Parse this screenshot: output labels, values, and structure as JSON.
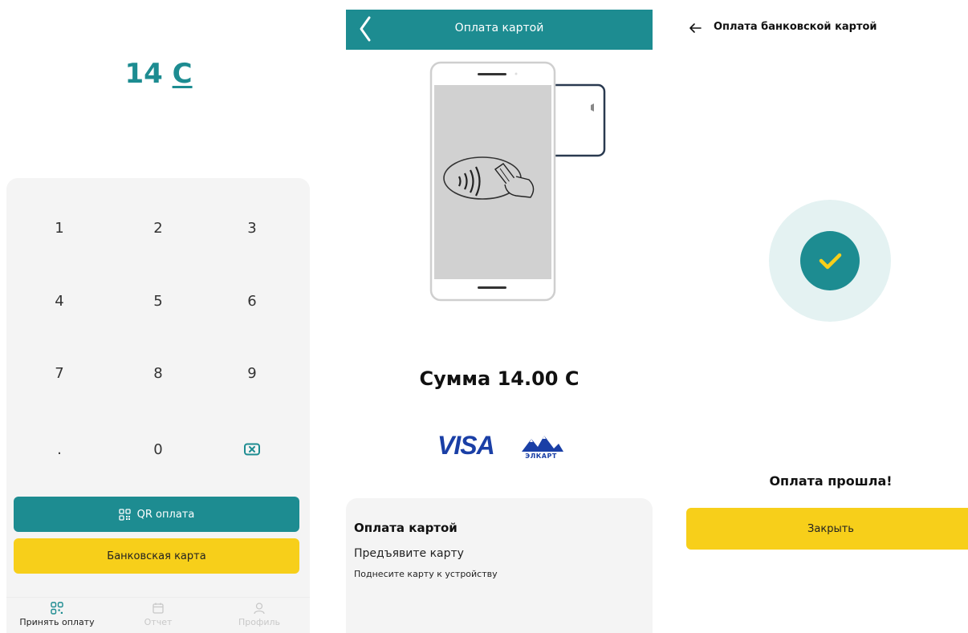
{
  "colors": {
    "teal": "#1d8c91",
    "yellow": "#f7cf1a",
    "light_gray": "#f4f4f4",
    "light_teal": "#e4f2f2"
  },
  "screen1": {
    "amount": "14",
    "currency": "С",
    "keys": [
      "1",
      "2",
      "3",
      "4",
      "5",
      "6",
      "7",
      "8",
      "9",
      ".",
      "0"
    ],
    "backspace_icon": "backspace-icon",
    "qr_button": "QR оплата",
    "card_button": "Банковская карта",
    "tabs": [
      {
        "label": "Принять оплату",
        "icon": "qr-code-icon",
        "active": true
      },
      {
        "label": "Отчет",
        "icon": "calendar-icon",
        "active": false
      },
      {
        "label": "Профиль",
        "icon": "profile-icon",
        "active": false
      }
    ]
  },
  "screen2": {
    "title": "Оплата картой",
    "back_icon": "chevron-left-icon",
    "sum": "Сумма 14.00 С",
    "visa": "VISA",
    "elcart": "ЭЛКАРТ",
    "card_title": "Оплата картой",
    "card_subtitle": "Предъявите карту",
    "card_hint": "Поднесите карту к устройству"
  },
  "screen3": {
    "title": "Оплата банковской картой",
    "back_icon": "arrow-left-icon",
    "success_icon": "check-icon",
    "message": "Оплата прошла!",
    "close_button": "Закрыть"
  }
}
